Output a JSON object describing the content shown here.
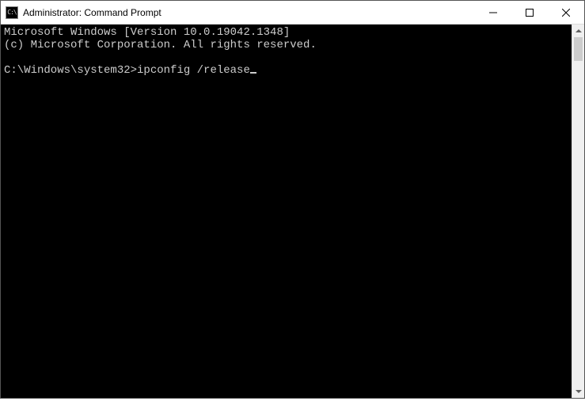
{
  "window": {
    "title": "Administrator: Command Prompt"
  },
  "terminal": {
    "line1": "Microsoft Windows [Version 10.0.19042.1348]",
    "line2": "(c) Microsoft Corporation. All rights reserved.",
    "blank": "",
    "prompt": "C:\\Windows\\system32>",
    "command": "ipconfig /release"
  }
}
